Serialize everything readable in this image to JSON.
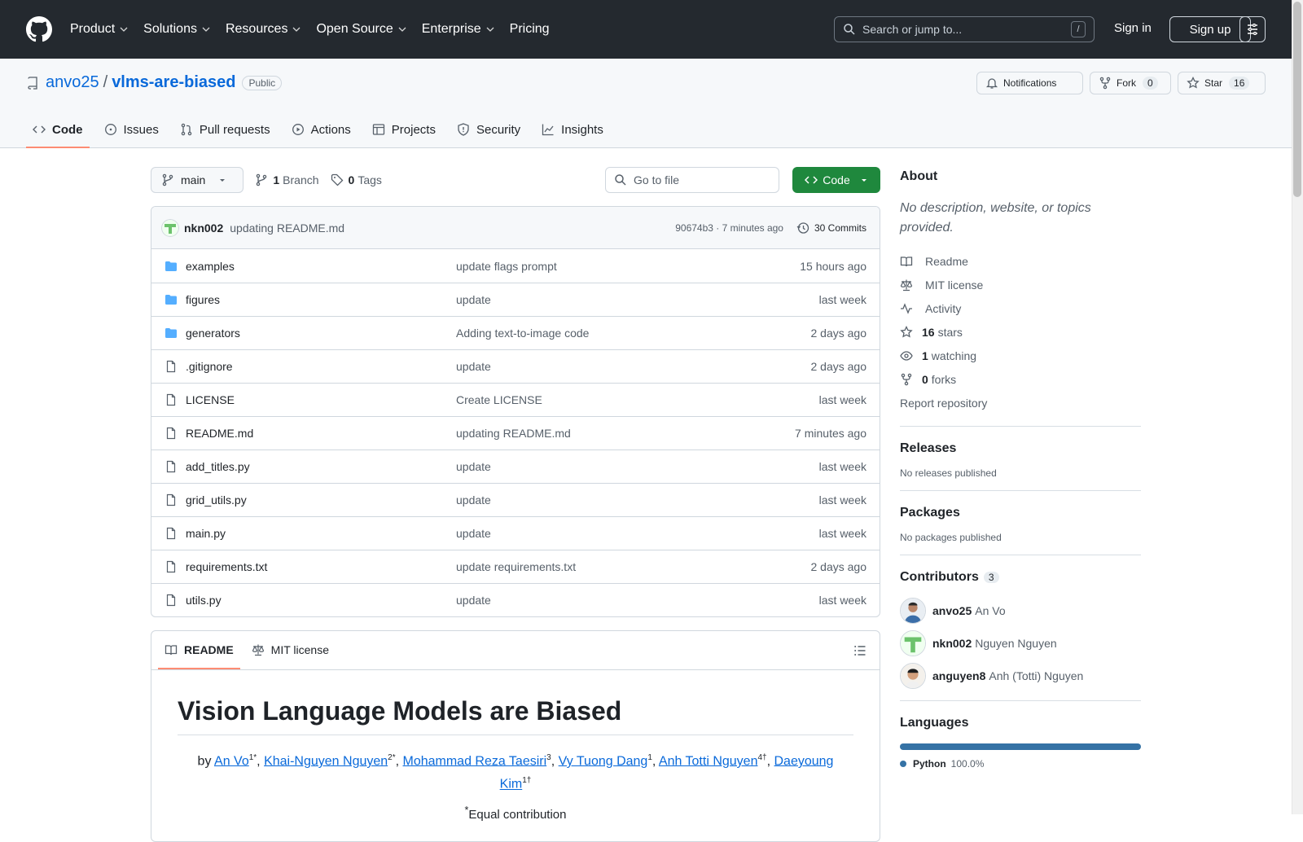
{
  "header": {
    "nav": [
      {
        "label": "Product",
        "dropdown": true
      },
      {
        "label": "Solutions",
        "dropdown": true
      },
      {
        "label": "Resources",
        "dropdown": true
      },
      {
        "label": "Open Source",
        "dropdown": true
      },
      {
        "label": "Enterprise",
        "dropdown": true
      },
      {
        "label": "Pricing",
        "dropdown": false
      }
    ],
    "search_placeholder": "Search or jump to...",
    "search_shortcut": "/",
    "signin": "Sign in",
    "signup": "Sign up"
  },
  "repo": {
    "owner": "anvo25",
    "separator": "/",
    "name": "vlms-are-biased",
    "visibility": "Public",
    "notifications_label": "Notifications",
    "fork_label": "Fork",
    "fork_count": "0",
    "star_label": "Star",
    "star_count": "16",
    "tabs": [
      {
        "label": "Code",
        "icon": "code-icon",
        "active": true
      },
      {
        "label": "Issues",
        "icon": "issue-icon"
      },
      {
        "label": "Pull requests",
        "icon": "pull-request-icon"
      },
      {
        "label": "Actions",
        "icon": "play-icon"
      },
      {
        "label": "Projects",
        "icon": "table-icon"
      },
      {
        "label": "Security",
        "icon": "shield-icon"
      },
      {
        "label": "Insights",
        "icon": "graph-icon"
      }
    ]
  },
  "toolbar": {
    "branch": "main",
    "branch_count": "1",
    "branch_label": "Branch",
    "tag_count": "0",
    "tag_label": "Tags",
    "goto_placeholder": "Go to file",
    "code_button": "Code"
  },
  "latest_commit": {
    "user": "nkn002",
    "message": "updating README.md",
    "meta": "90674b3 · 7 minutes ago",
    "commits": "30 Commits"
  },
  "files": [
    {
      "type": "folder",
      "name": "examples",
      "message": "update flags prompt",
      "time": "15 hours ago"
    },
    {
      "type": "folder",
      "name": "figures",
      "message": "update",
      "time": "last week"
    },
    {
      "type": "folder",
      "name": "generators",
      "message": "Adding text-to-image code",
      "time": "2 days ago"
    },
    {
      "type": "file",
      "name": ".gitignore",
      "message": "update",
      "time": "2 days ago"
    },
    {
      "type": "file",
      "name": "LICENSE",
      "message": "Create LICENSE",
      "time": "last week"
    },
    {
      "type": "file",
      "name": "README.md",
      "message": "updating README.md",
      "time": "7 minutes ago"
    },
    {
      "type": "file",
      "name": "add_titles.py",
      "message": "update",
      "time": "last week"
    },
    {
      "type": "file",
      "name": "grid_utils.py",
      "message": "update",
      "time": "last week"
    },
    {
      "type": "file",
      "name": "main.py",
      "message": "update",
      "time": "last week"
    },
    {
      "type": "file",
      "name": "requirements.txt",
      "message": "update requirements.txt",
      "time": "2 days ago"
    },
    {
      "type": "file",
      "name": "utils.py",
      "message": "update",
      "time": "last week"
    }
  ],
  "readme": {
    "tab_readme": "README",
    "tab_license": "MIT license",
    "title": "Vision Language Models are Biased",
    "by": "by",
    "authors": [
      {
        "name": "An Vo",
        "sup": "1*"
      },
      {
        "name": "Khai-Nguyen Nguyen",
        "sup": "2*"
      },
      {
        "name": "Mohammad Reza Taesiri",
        "sup": "3"
      },
      {
        "name": "Vy Tuong Dang",
        "sup": "1"
      },
      {
        "name": "Anh Totti Nguyen",
        "sup": "4†"
      },
      {
        "name": "Daeyoung Kim",
        "sup": "1†"
      }
    ],
    "equal_sup": "*",
    "equal_contribution": "Equal contribution"
  },
  "sidebar": {
    "about_title": "About",
    "about_desc": "No description, website, or topics provided.",
    "links": [
      {
        "icon": "book-icon",
        "count": "",
        "label": "Readme"
      },
      {
        "icon": "law-icon",
        "count": "",
        "label": "MIT license"
      },
      {
        "icon": "pulse-icon",
        "count": "",
        "label": "Activity"
      },
      {
        "icon": "star-icon",
        "count": "16",
        "label": "stars"
      },
      {
        "icon": "eye-icon",
        "count": "1",
        "label": "watching"
      },
      {
        "icon": "fork-icon",
        "count": "0",
        "label": "forks"
      }
    ],
    "report": "Report repository",
    "releases_title": "Releases",
    "releases_text": "No releases published",
    "packages_title": "Packages",
    "packages_text": "No packages published",
    "contributors_title": "Contributors",
    "contributors_count": "3",
    "contributors": [
      {
        "login": "anvo25",
        "name": "An Vo"
      },
      {
        "login": "nkn002",
        "name": "Nguyen Nguyen"
      },
      {
        "login": "anguyen8",
        "name": "Anh (Totti) Nguyen"
      }
    ],
    "languages_title": "Languages",
    "language": {
      "name": "Python",
      "percent": "100.0%",
      "color": "#3572a5"
    }
  },
  "colors": {
    "accent_blue": "#0969da",
    "code_green": "#1f883d",
    "tab_underline": "#fd8c73",
    "header_dark": "#24292f"
  }
}
